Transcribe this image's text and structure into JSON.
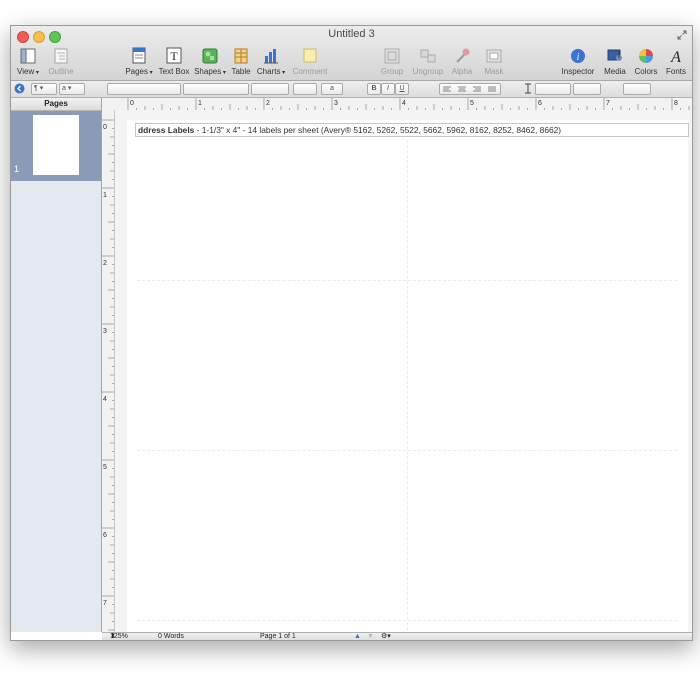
{
  "window": {
    "title": "Untitled 3"
  },
  "toolbar": {
    "left": [
      {
        "name": "view",
        "label": "View",
        "has_menu": true
      },
      {
        "name": "outline",
        "label": "Outline",
        "disabled": true
      }
    ],
    "center": [
      {
        "name": "pages",
        "label": "Pages",
        "has_menu": true
      },
      {
        "name": "text-box",
        "label": "Text Box"
      },
      {
        "name": "shapes",
        "label": "Shapes",
        "has_menu": true
      },
      {
        "name": "table",
        "label": "Table"
      },
      {
        "name": "charts",
        "label": "Charts",
        "has_menu": true
      },
      {
        "name": "comment",
        "label": "Comment",
        "disabled": true
      }
    ],
    "arrange": [
      {
        "name": "group",
        "label": "Group",
        "disabled": true
      },
      {
        "name": "ungroup",
        "label": "Ungroup",
        "disabled": true
      },
      {
        "name": "alpha",
        "label": "Alpha",
        "disabled": true
      },
      {
        "name": "mask",
        "label": "Mask",
        "disabled": true
      }
    ],
    "right": [
      {
        "name": "inspector",
        "label": "Inspector"
      },
      {
        "name": "media",
        "label": "Media"
      },
      {
        "name": "colors",
        "label": "Colors"
      },
      {
        "name": "fonts",
        "label": "Fonts"
      }
    ]
  },
  "format_bar": {
    "paragraph_style": "¶",
    "character_style": "a",
    "bold": "B",
    "italic": "I",
    "underline": "U",
    "text_color": "a"
  },
  "sidebar": {
    "header": "Pages",
    "thumbnails": [
      {
        "number": "1",
        "selected": true
      }
    ]
  },
  "rulers": {
    "horizontal": [
      "0",
      "1",
      "2",
      "3",
      "4",
      "5",
      "6",
      "7",
      "8"
    ],
    "vertical": [
      "0",
      "1",
      "2",
      "3",
      "4",
      "5",
      "6",
      "7"
    ]
  },
  "document": {
    "label_title_bold": "ddress Labels",
    "label_title_rest": " - 1-1/3\" x 4\" - 14 labels per sheet (Avery® 5162, 5262, 5522, 5662, 5962, 8162, 8252, 8462, 8662)"
  },
  "status": {
    "zoom": "125%",
    "word_count": "0 Words",
    "page_indicator": "Page 1 of 1"
  },
  "colors": {
    "sidebar_bg": "#e4e9f0",
    "thumbnail_selected": "#8a9bb8",
    "accent_blue": "#3a73d0"
  }
}
